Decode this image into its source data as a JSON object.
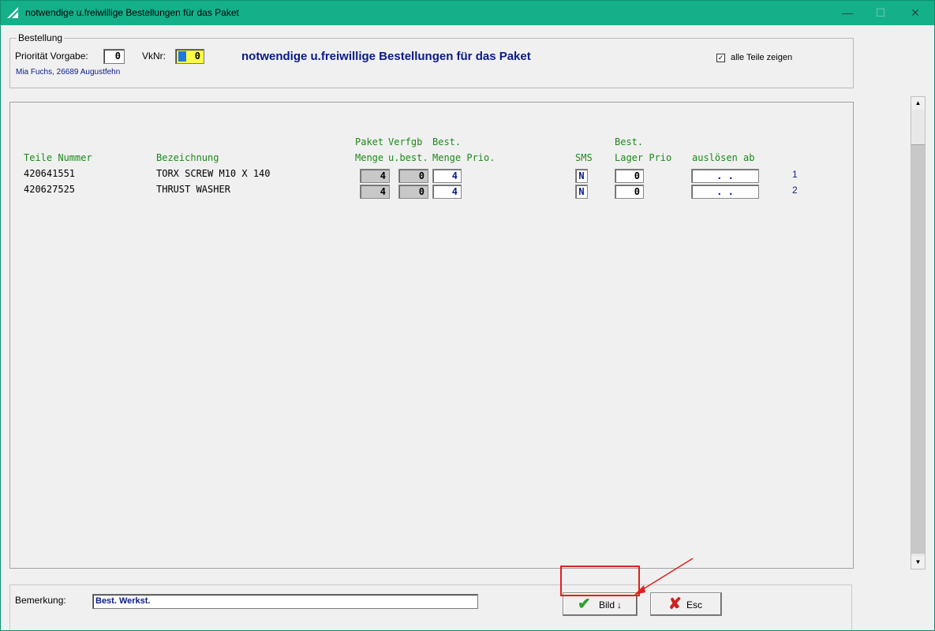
{
  "window": {
    "title": "notwendige u.freiwillige Bestellungen für das Paket",
    "controls": {
      "minimize": "—",
      "maximize": "☐",
      "close": "✕"
    }
  },
  "bestellung": {
    "legend": "Bestellung",
    "prioritaet_label": "Priorität Vorgabe:",
    "prioritaet_value": "0",
    "vknr_label": "VkNr:",
    "vknr_value": "0",
    "heading": "notwendige u.freiwillige Bestellungen für das Paket",
    "address": "Mia Fuchs, 26689 Augustfehn",
    "alle_teile_label": "alle Teile zeigen",
    "alle_teile_checked": true,
    "check_mark": "✓"
  },
  "table": {
    "headers_top": {
      "paket": "Paket",
      "verfgb": "Verfgb",
      "best": "Best.",
      "best2": "Best."
    },
    "headers": {
      "teile_nummer": "Teile Nummer",
      "bezeichnung": "Bezeichnung",
      "menge": "Menge",
      "ubest": "u.best.",
      "menge_prio": "Menge Prio.",
      "sms": "SMS",
      "lager_prio": "Lager Prio",
      "ausloesen_ab": "auslösen ab"
    },
    "rows": [
      {
        "teile_nummer": "420641551",
        "bezeichnung": "TORX SCREW M10 X 140",
        "menge": "4",
        "ubest": "0",
        "best_menge": "4",
        "sms": "N",
        "lager": "0",
        "ausloesen": ". .",
        "num": "1"
      },
      {
        "teile_nummer": "420627525",
        "bezeichnung": "THRUST WASHER",
        "menge": "4",
        "ubest": "0",
        "best_menge": "4",
        "sms": "N",
        "lager": "0",
        "ausloesen": ". .",
        "num": "2"
      }
    ]
  },
  "footer": {
    "bemerkung_label": "Bemerkung:",
    "bemerkung_value": "Best. Werkst.",
    "bild_label": "Bild",
    "bild_arrow": "↓",
    "esc_label": "Esc",
    "bild_icon": "check-icon",
    "esc_icon": "x-icon"
  },
  "colors": {
    "titlebar": "#13b08a",
    "heading": "#0a1a8a",
    "column_header": "#1a8a1a",
    "highlight": "#e02020"
  }
}
